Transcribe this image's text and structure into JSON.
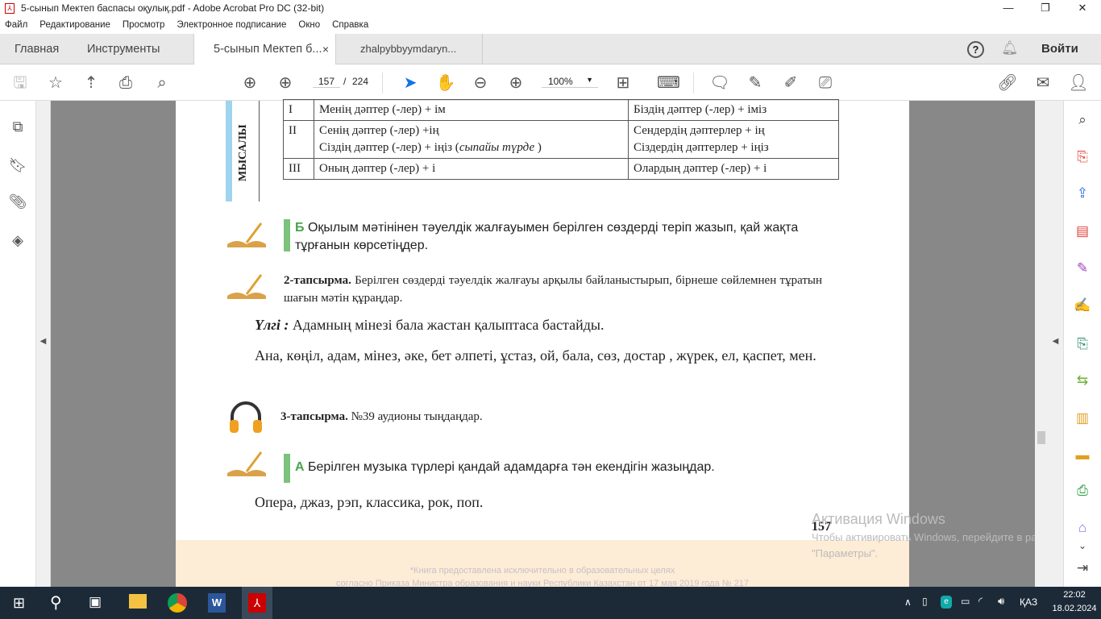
{
  "window": {
    "title": "5-сынып Мектеп баспасы оқулық.pdf - Adobe Acrobat Pro DC (32-bit)",
    "minimize": "—",
    "maximize": "❐",
    "close": "✕"
  },
  "menu": [
    "Файл",
    "Редактирование",
    "Просмотр",
    "Электронное подписание",
    "Окно",
    "Справка"
  ],
  "tabs": {
    "home": "Главная",
    "tools": "Инструменты",
    "doc1": "5-сынып Мектеп б...",
    "doc1_close": "×",
    "doc2": "zhalpybbyymdaryn..."
  },
  "header_right": {
    "help": "?",
    "signin": "Войти"
  },
  "toolbar": {
    "page_current": "157",
    "page_sep": "/",
    "page_total": "224",
    "zoom": "100%"
  },
  "page": {
    "side_label": "МЫСАЛЫ",
    "table": [
      {
        "person": "I",
        "singular": "Менің  дәптер  (-лер)  +  ім",
        "plural": "Біздің  дәптер  (-лер)  +  іміз"
      },
      {
        "person": "II",
        "singular": "Сенің  дәптер  (-лер)  +ің",
        "singular2": "Сіздің  дәптер  (-лер)  +  іңіз  (",
        "singular2_italic": "сыпайы  түрде",
        "singular2_end": " )",
        "plural": "Сендердің  дәптерлер  +  ің",
        "plural2": "Сіздердің  дәптерлер  +  іңіз"
      },
      {
        "person": "III",
        "singular": "Оның  дәптер  (-лер)  +  і",
        "plural": "Олардың  дәптер  (-лер)  +  і"
      }
    ],
    "taskB_letter": "Б",
    "taskB": "Оқылым мәтінінен тәуелдік жалғауымен берілген сөздерді теріп жазып, қай жақта тұрғанын көрсетіңдер.",
    "task2_label": "2-тапсырма.",
    "task2": "Берілген  сөздерді  тәуелдік  жалғауы  арқылы  байланыстырып, бірнеше  сөйлемнен  тұратын  шағын  мәтін  құраңдар.",
    "sample_label": "Үлгі :",
    "sample": "Адамның   мінезі   бала  жастан   қалыптаса    бастайды.",
    "words": "Ана,  көңіл,  адам,  мінез,  әке,  бет  әлпеті,  ұстаз,  ой,  бала,  сөз,  достар ,  жүрек,   ел,  қаспет,    мен.",
    "task3_label": "3-тапсырма.",
    "task3": "№39  аудионы   тыңдаңдар.",
    "taskA_letter": "А",
    "taskA": "Берілген музыка түрлері қандай адамдарға тән екендігін жазыңдар.",
    "music": "Опера,  джаз,  рэп,  классика,    рок,  поп.",
    "page_number": "157",
    "footer1": "*Книга предоставлена исключительно в образовательных целях",
    "footer2": "согласно Приказа Министра образования и науки Республики Казахстан от 17 мая 2019 года № 217"
  },
  "watermark": {
    "title": "Активация Windows",
    "text": "Чтобы активировать Windows, перейдите в раздел \"Параметры\"."
  },
  "taskbar": {
    "lang": "ҚАЗ",
    "time": "22:02",
    "date": "18.02.2024"
  }
}
